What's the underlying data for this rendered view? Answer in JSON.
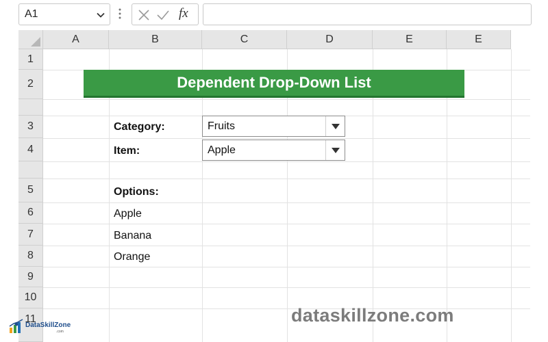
{
  "formula_bar": {
    "name_box": "A1",
    "fx_label": "fx",
    "formula_value": ""
  },
  "columns": [
    "A",
    "B",
    "C",
    "D",
    "E",
    "E"
  ],
  "rows": [
    "1",
    "2",
    "3",
    "4",
    "5",
    "6",
    "7",
    "8",
    "9",
    "10",
    "11"
  ],
  "sheet": {
    "title": "Dependent Drop-Down List",
    "category_label": "Category:",
    "category_value": "Fruits",
    "item_label": "Item:",
    "item_value": "Apple",
    "options_label": "Options:",
    "options": [
      "Apple",
      "Banana",
      "Orange"
    ]
  },
  "watermark": "dataskillzone.com",
  "logo": {
    "name": "DataSkillZone",
    "sub": ".com"
  },
  "colors": {
    "banner": "#3a9a45",
    "banner_border": "#23752f",
    "header_bg": "#e6e6e6",
    "gridline": "#e2e2e2"
  },
  "icons": {
    "name_box_dropdown": "chevron-down-icon",
    "cancel": "x-icon",
    "enter": "check-icon",
    "insert_function": "fx-icon"
  }
}
